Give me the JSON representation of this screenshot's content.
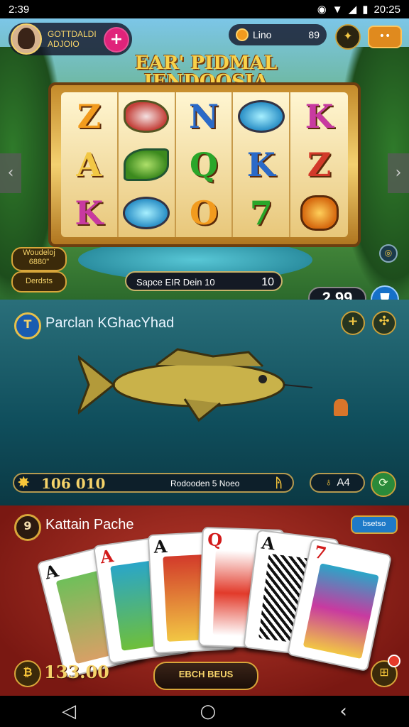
{
  "status_bar": {
    "time": "2:39",
    "right_time": "20:25"
  },
  "slot": {
    "profile_name_line1": "GOTTDALDI",
    "profile_name_line2": "ADJOIO",
    "add_label": "+",
    "coins_label": "Lino",
    "coins_value": "89",
    "title_line1": "EAR' PIDMAL",
    "title_line2": "IENDOOSIA",
    "reels": [
      "Z",
      "meat",
      "N",
      "gem",
      "K",
      "A",
      "leaf",
      "Q",
      "K",
      "Z",
      "K",
      "gem",
      "O",
      "7",
      "face"
    ],
    "left_badge_1_line1": "Woudeloj",
    "left_badge_1_line2": "6880\"",
    "left_badge_2": "Derdsts",
    "spin_label": "Sapce EIR Dein 10",
    "spin_end": "10",
    "bet_value": "2,99"
  },
  "fishing": {
    "badge": "T",
    "title": "Parclan KGhacYhad",
    "value": "106 010",
    "label": "Rodooden 5 Noeo",
    "pill_value": "A4"
  },
  "cards": {
    "badge": "9",
    "title": "Kattain Pache",
    "tag": "bsetso",
    "ranks": [
      "A",
      "A",
      "A",
      "Q",
      "A",
      "7"
    ],
    "value": "133.00",
    "button": "EBCH BEUS"
  },
  "colors": {
    "gold": "#f5d36a",
    "pink": "#e0237a",
    "blue": "#1670c8"
  }
}
